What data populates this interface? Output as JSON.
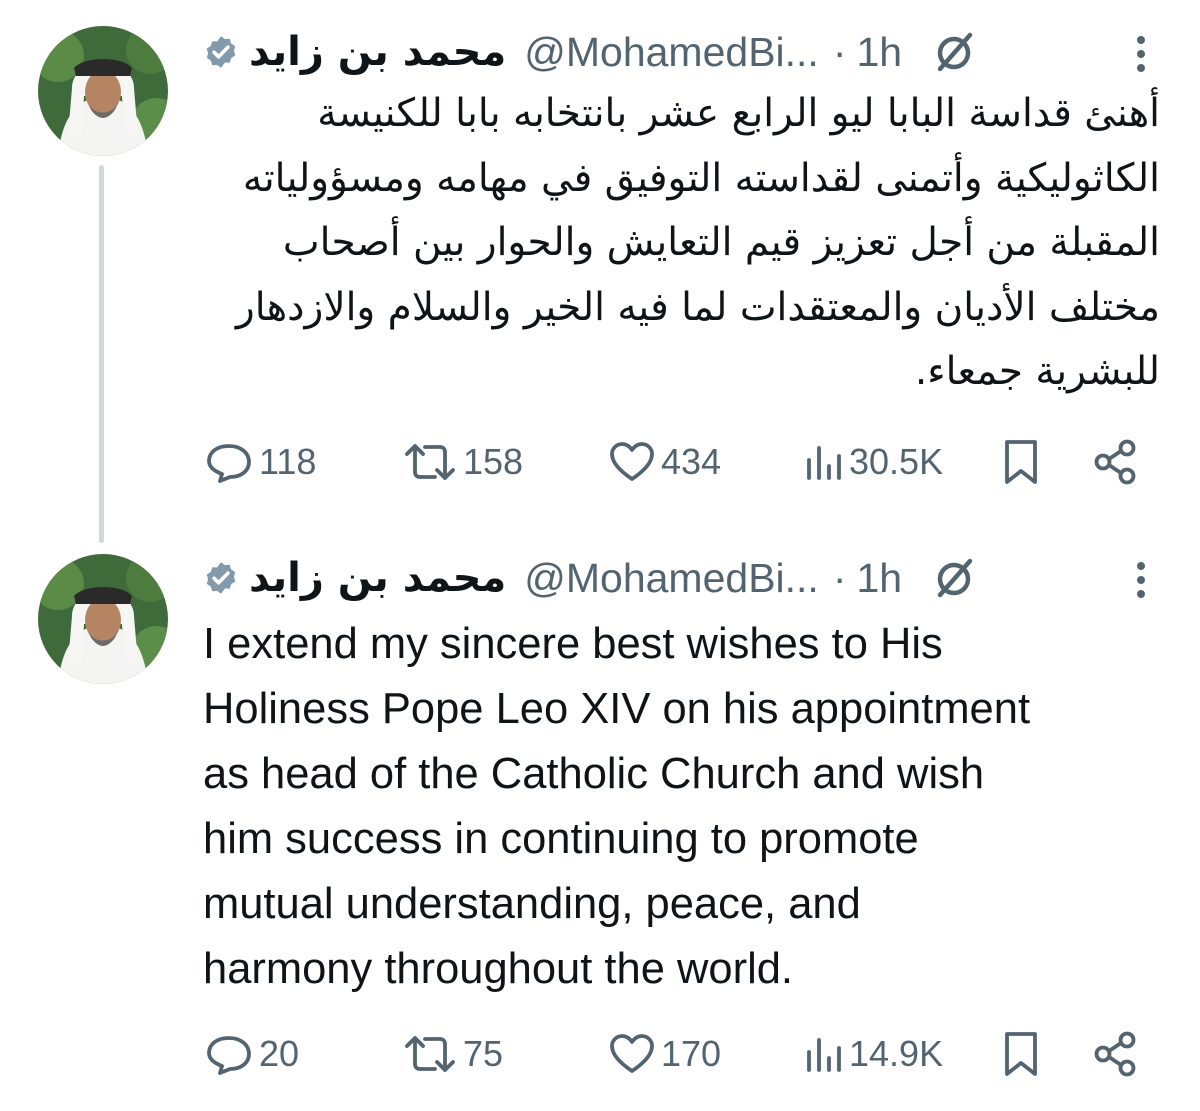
{
  "tweets": [
    {
      "display_name": "محمد بن زايد",
      "handle": "@MohamedBi...",
      "separator": "·",
      "time": "1h",
      "text": "أهنئ قداسة البابا ليو الرابع عشر بانتخابه بابا للكنيسة الكاثوليكية وأتمنى لقداسته التوفيق في مهامه ومسؤولياته المقبلة من أجل تعزيز قيم التعايش والحوار بين أصحاب مختلف الأديان والمعتقدات لما فيه الخير والسلام والازدهار للبشرية جمعاء.",
      "replies": "118",
      "reposts": "158",
      "likes": "434",
      "views": "30.5K"
    },
    {
      "display_name": "محمد بن زايد",
      "handle": "@MohamedBi...",
      "separator": "·",
      "time": "1h",
      "text": "I extend my sincere best wishes to His\nHoliness Pope Leo XIV on his appointment\nas head of the Catholic Church and wish\nhim success in continuing to promote\nmutual understanding, peace, and\nharmony throughout the world.",
      "replies": "20",
      "reposts": "75",
      "likes": "170",
      "views": "14.9K"
    }
  ],
  "colors": {
    "text": "#0f1419",
    "secondary": "#536471",
    "thread_line": "#cfd9de",
    "verified_badge": "#829aab"
  },
  "icons": {
    "verified": "verified-badge-icon",
    "grok": "grok-icon",
    "more": "more-vertical-icon",
    "reply": "reply-icon",
    "repost": "repost-icon",
    "like": "heart-icon",
    "views": "views-bar-chart-icon",
    "bookmark": "bookmark-icon",
    "share": "share-icon"
  }
}
